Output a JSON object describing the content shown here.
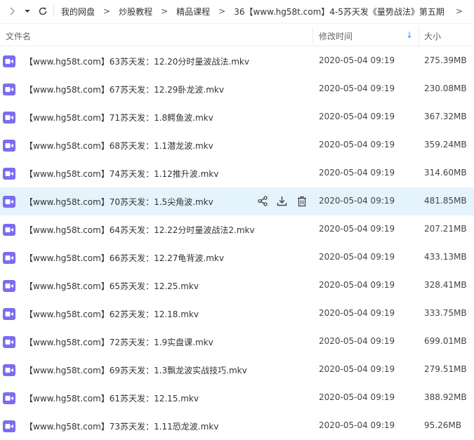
{
  "breadcrumb": {
    "items": [
      "我的网盘",
      "炒股教程",
      "精品课程",
      "36【www.hg58t.com】4-5苏天发《量势战法》第五期"
    ],
    "separator": ">"
  },
  "header": {
    "name_label": "文件名",
    "time_label": "修改时间",
    "size_label": "大小",
    "sort_arrow": "↓"
  },
  "colors": {
    "accent": "#3b8cff",
    "row_highlight": "#e5f3fd",
    "video_icon": "#7b6df0"
  },
  "files": [
    {
      "name": "【www.hg58t.com】63苏天发：12.20分时量波战法.mkv",
      "time": "2020-05-04 09:19",
      "size": "275.39MB"
    },
    {
      "name": "【www.hg58t.com】67苏天发：12.29卧龙波.mkv",
      "time": "2020-05-04 09:19",
      "size": "230.08MB"
    },
    {
      "name": "【www.hg58t.com】71苏天发：1.8鳄鱼波.mkv",
      "time": "2020-05-04 09:19",
      "size": "367.32MB"
    },
    {
      "name": "【www.hg58t.com】68苏天发：1.1潜龙波.mkv",
      "time": "2020-05-04 09:19",
      "size": "359.24MB"
    },
    {
      "name": "【www.hg58t.com】74苏天发：1.12推升波.mkv",
      "time": "2020-05-04 09:19",
      "size": "314.60MB"
    },
    {
      "name": "【www.hg58t.com】70苏天发：1.5尖角波.mkv",
      "time": "2020-05-04 09:19",
      "size": "481.85MB"
    },
    {
      "name": "【www.hg58t.com】64苏天发：12.22分时量波战法2.mkv",
      "time": "2020-05-04 09:19",
      "size": "207.21MB"
    },
    {
      "name": "【www.hg58t.com】66苏天发：12.27龟背波.mkv",
      "time": "2020-05-04 09:19",
      "size": "433.13MB"
    },
    {
      "name": "【www.hg58t.com】65苏天发：12.25.mkv",
      "time": "2020-05-04 09:19",
      "size": "328.41MB"
    },
    {
      "name": "【www.hg58t.com】62苏天发：12.18.mkv",
      "time": "2020-05-04 09:19",
      "size": "333.75MB"
    },
    {
      "name": "【www.hg58t.com】72苏天发：1.9实盘课.mkv",
      "time": "2020-05-04 09:19",
      "size": "699.01MB"
    },
    {
      "name": "【www.hg58t.com】69苏天发：1.3飘龙波实战技巧.mkv",
      "time": "2020-05-04 09:19",
      "size": "279.51MB"
    },
    {
      "name": "【www.hg58t.com】61苏天发：12.15.mkv",
      "time": "2020-05-04 09:19",
      "size": "388.92MB"
    },
    {
      "name": "【www.hg58t.com】73苏天发：1.11恐龙波.mkv",
      "time": "2020-05-04 09:19",
      "size": "95.26MB"
    }
  ],
  "highlighted_index": 5
}
